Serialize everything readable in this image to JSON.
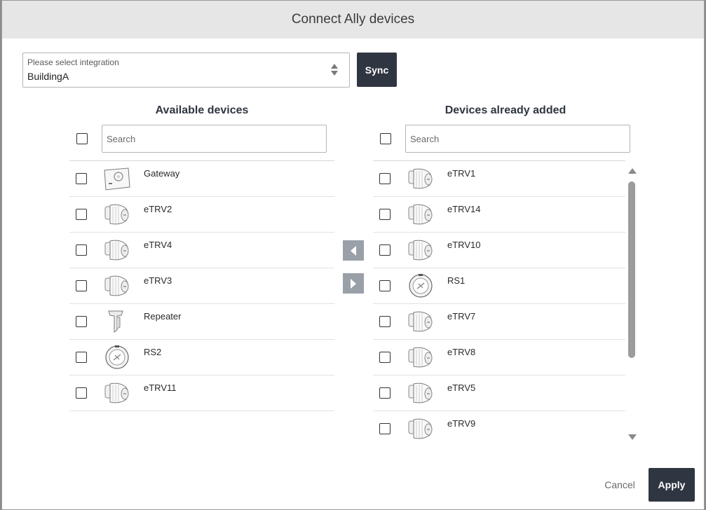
{
  "dialog": {
    "title": "Connect Ally devices"
  },
  "integration": {
    "label": "Please select integration",
    "value": "BuildingA"
  },
  "sync_label": "Sync",
  "available": {
    "title": "Available devices",
    "search_placeholder": "Search",
    "items": [
      {
        "label": "Gateway",
        "icon": "gateway-icon"
      },
      {
        "label": "eTRV2",
        "icon": "thermostat-valve-icon"
      },
      {
        "label": "eTRV4",
        "icon": "thermostat-valve-icon"
      },
      {
        "label": "eTRV3",
        "icon": "thermostat-valve-icon"
      },
      {
        "label": "Repeater",
        "icon": "repeater-icon"
      },
      {
        "label": "RS2",
        "icon": "room-sensor-icon"
      },
      {
        "label": "eTRV11",
        "icon": "thermostat-valve-icon"
      }
    ]
  },
  "added": {
    "title": "Devices already added",
    "search_placeholder": "Search",
    "items": [
      {
        "label": "eTRV1",
        "icon": "thermostat-valve-icon"
      },
      {
        "label": "eTRV14",
        "icon": "thermostat-valve-icon"
      },
      {
        "label": "eTRV10",
        "icon": "thermostat-valve-icon"
      },
      {
        "label": "RS1",
        "icon": "room-sensor-icon"
      },
      {
        "label": "eTRV7",
        "icon": "thermostat-valve-icon"
      },
      {
        "label": "eTRV8",
        "icon": "thermostat-valve-icon"
      },
      {
        "label": "eTRV5",
        "icon": "thermostat-valve-icon"
      },
      {
        "label": "eTRV9",
        "icon": "thermostat-valve-icon"
      }
    ]
  },
  "footer": {
    "cancel_label": "Cancel",
    "apply_label": "Apply"
  },
  "colors": {
    "primary_button": "#303641",
    "arrow_button": "#9aa0a8",
    "header_bg": "#e6e6e6"
  }
}
